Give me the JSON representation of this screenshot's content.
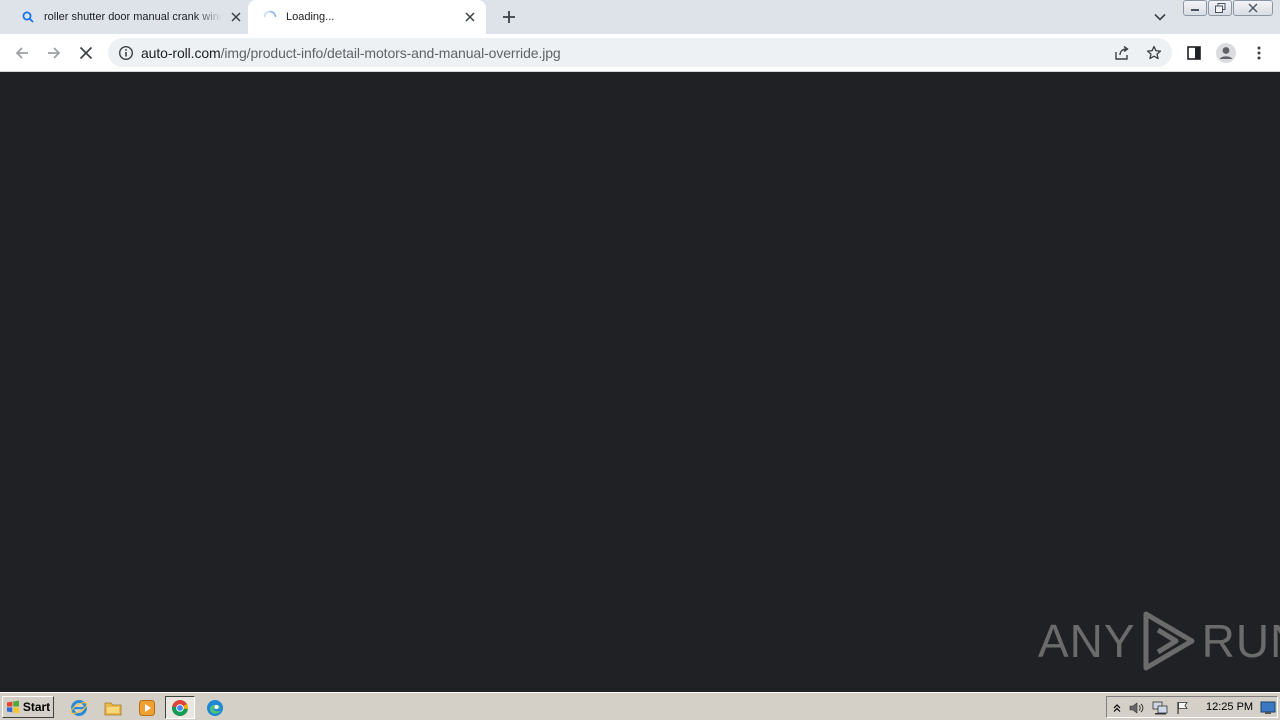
{
  "tabs": [
    {
      "title": "roller shutter door manual crank winch",
      "icon": "search-icon",
      "active": false
    },
    {
      "title": "Loading...",
      "icon": "loading-spinner-icon",
      "active": true
    }
  ],
  "address_bar": {
    "host": "auto-roll.com",
    "path": "/img/product-info/detail-motors-and-manual-override.jpg"
  },
  "watermark": {
    "left": "ANY",
    "right": "RUN"
  },
  "taskbar": {
    "start_label": "Start",
    "clock": "12:25 PM"
  },
  "colors": {
    "content_bg": "#202124",
    "tabstrip_bg": "#dee3ea",
    "taskbar_bg": "#d4d0c8"
  }
}
